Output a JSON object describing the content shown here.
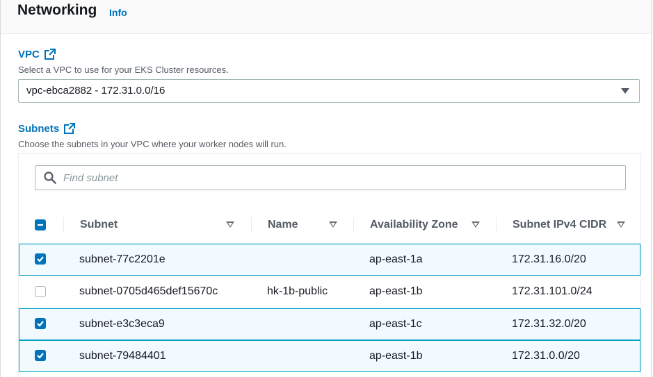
{
  "header": {
    "title": "Networking",
    "info_label": "Info"
  },
  "vpc": {
    "label": "VPC",
    "description": "Select a VPC to use for your EKS Cluster resources.",
    "selected": "vpc-ebca2882 - 172.31.0.0/16",
    "icon": "external-link-icon"
  },
  "subnets": {
    "label": "Subnets",
    "description": "Choose the subnets in your VPC where your worker nodes will run.",
    "search_placeholder": "Find subnet",
    "select_all_state": "indeterminate",
    "columns": [
      "Subnet",
      "Name",
      "Availability Zone",
      "Subnet IPv4 CIDR"
    ],
    "rows": [
      {
        "subnet": "subnet-77c2201e",
        "name": "",
        "az": "ap-east-1a",
        "cidr": "172.31.16.0/20",
        "checked": true
      },
      {
        "subnet": "subnet-0705d465def15670c",
        "name": "hk-1b-public",
        "az": "ap-east-1b",
        "cidr": "172.31.101.0/24",
        "checked": false
      },
      {
        "subnet": "subnet-e3c3eca9",
        "name": "",
        "az": "ap-east-1c",
        "cidr": "172.31.32.0/20",
        "checked": true
      },
      {
        "subnet": "subnet-79484401",
        "name": "",
        "az": "ap-east-1b",
        "cidr": "172.31.0.0/20",
        "checked": true
      }
    ]
  },
  "colors": {
    "accent": "#0073bb",
    "selected_row_bg": "#f1faff",
    "selected_row_border": "#00a1c9"
  }
}
